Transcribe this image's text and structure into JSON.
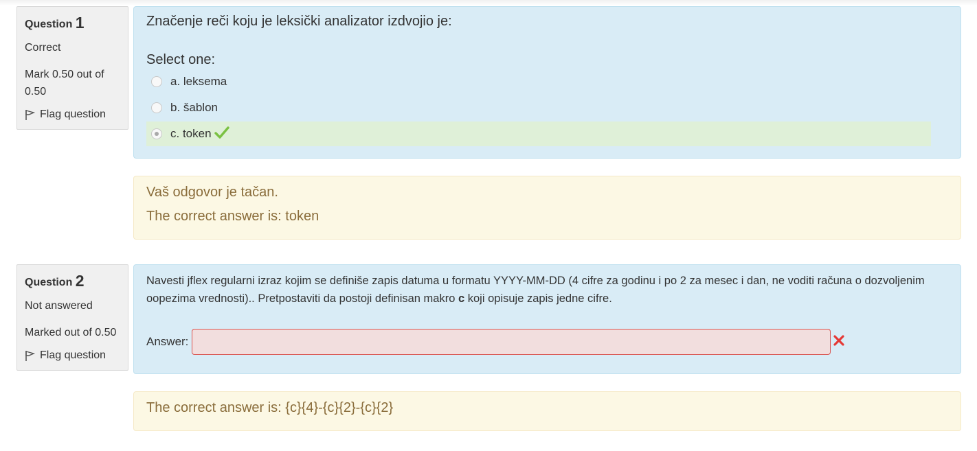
{
  "questions": [
    {
      "label": "Question",
      "number": "1",
      "state": "Correct",
      "grade": "Mark 0.50 out of 0.50",
      "flag_label": "Flag question",
      "text": "Značenje reči koju je leksički analizator izdvojio je:",
      "prompt": "Select one:",
      "options": [
        {
          "label": "a. leksema",
          "selected": false
        },
        {
          "label": "b. šablon",
          "selected": false
        },
        {
          "label": "c. token",
          "selected": true,
          "correct": true
        }
      ],
      "feedback_general": "Vaš odgovor je tačan.",
      "feedback_right": "The correct answer is: token"
    },
    {
      "label": "Question",
      "number": "2",
      "state": "Not answered",
      "grade": "Marked out of 0.50",
      "flag_label": "Flag question",
      "text_part1": "Navesti jflex regularni izraz kojim se definiše zapis datuma u formatu YYYY-MM-DD (4 cifre za godinu i po 2 za mesec i dan, ne voditi računa o dozvoljenim oopezima vrednosti).. Pretpostaviti da postoji definisan makro ",
      "text_bold": "c",
      "text_part2": " koji opisuje zapis jedne cifre.",
      "answer_label": "Answer:",
      "answer_value": "",
      "feedback_right": "The correct answer is: {c}{4}-{c}{2}-{c}{2}"
    }
  ],
  "colors": {
    "formulation_bg": "#d9ecf6",
    "feedback_bg": "#fcf8e4",
    "correct_option_bg": "#dff0d8",
    "incorrect_input_bg": "#f2dede",
    "check_green": "#7ac142",
    "cross_red": "#e53935"
  },
  "icons": [
    "flag-icon",
    "check-icon",
    "cross-icon"
  ]
}
